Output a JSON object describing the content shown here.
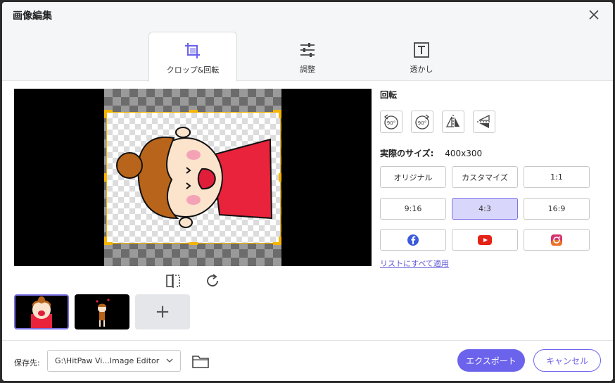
{
  "window": {
    "title": "画像編集"
  },
  "tabs": [
    {
      "label": "クロップ&回転",
      "icon": "crop-icon"
    },
    {
      "label": "調整",
      "icon": "sliders-icon"
    },
    {
      "label": "透かし",
      "icon": "watermark-text-icon"
    }
  ],
  "side": {
    "rotate_label": "回転",
    "rotate_ccw_text": "90°",
    "rotate_cw_text": "90°",
    "size_label": "実際のサイズ:",
    "size_value": "400x300",
    "ratios": [
      {
        "label": "オリジナル"
      },
      {
        "label": "カスタマイズ"
      },
      {
        "label": "1:1"
      },
      {
        "label": "9:16"
      },
      {
        "label": "4:3",
        "selected": true
      },
      {
        "label": "16:9"
      }
    ],
    "social": [
      "facebook-icon",
      "youtube-icon",
      "instagram-icon"
    ],
    "apply_all": "リストにすべて適用"
  },
  "thumbs": {
    "add_label": "+"
  },
  "footer": {
    "save_label": "保存先:",
    "path_value": "G:\\HitPaw Vi...Image Editor",
    "export_label": "エクスポート",
    "cancel_label": "キャンセル"
  },
  "colors": {
    "accent": "#6c63ec",
    "selected_bg": "#d9d6fb",
    "crop_handle": "#f5b400"
  }
}
